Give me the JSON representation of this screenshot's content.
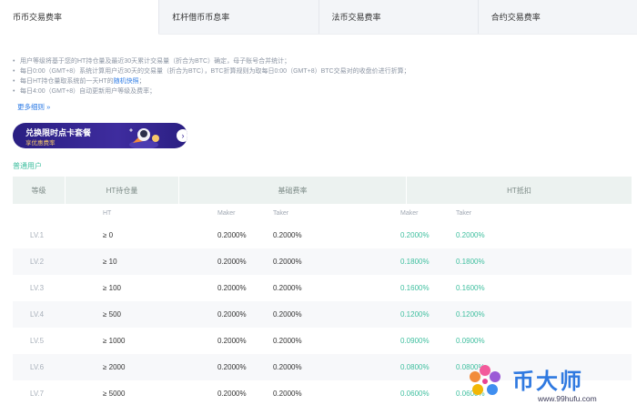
{
  "tabs": [
    {
      "label": "币币交易费率",
      "active": true
    },
    {
      "label": "杠杆借币币息率",
      "active": false
    },
    {
      "label": "法币交易费率",
      "active": false
    },
    {
      "label": "合约交易费率",
      "active": false
    }
  ],
  "notes": {
    "line1": "用户等级将基于您的HT持仓量及最近30天累计交易量（折合为BTC）确定，母子账号合并统计；",
    "line2": "每日0:00（GMT+8）系统计算用户近30天的交易量（折合为BTC），BTC折算规则为取每日0:00（GMT+8）BTC交易对的收盘价进行折算；",
    "line3_prefix": "每日HT持仓量取系统前一天HT的",
    "line3_link": "随机快照",
    "line3_suffix": "；",
    "line4": "每日4:00（GMT+8）自动更新用户等级及费率；",
    "more": "更多细则 »"
  },
  "banner": {
    "title": "兑换限时点卡套餐",
    "subtitle": "享优惠费率",
    "arrow": "›"
  },
  "section_title": "普通用户",
  "table": {
    "headers": {
      "level": "等级",
      "ht_holding": "HT持仓量",
      "base_rate": "基础费率",
      "ht_deduct": "HT抵扣"
    },
    "subheaders": {
      "ht": "HT",
      "maker": "Maker",
      "taker": "Taker",
      "ht_maker": "Maker",
      "ht_taker": "Taker"
    },
    "rows": [
      {
        "level": "LV.1",
        "ht": "≥ 0",
        "maker": "0.2000%",
        "taker": "0.2000%",
        "ht_maker": "0.2000%",
        "ht_taker": "0.2000%"
      },
      {
        "level": "LV.2",
        "ht": "≥ 10",
        "maker": "0.2000%",
        "taker": "0.2000%",
        "ht_maker": "0.1800%",
        "ht_taker": "0.1800%"
      },
      {
        "level": "LV.3",
        "ht": "≥ 100",
        "maker": "0.2000%",
        "taker": "0.2000%",
        "ht_maker": "0.1600%",
        "ht_taker": "0.1600%"
      },
      {
        "level": "LV.4",
        "ht": "≥ 500",
        "maker": "0.2000%",
        "taker": "0.2000%",
        "ht_maker": "0.1200%",
        "ht_taker": "0.1200%"
      },
      {
        "level": "LV.5",
        "ht": "≥ 1000",
        "maker": "0.2000%",
        "taker": "0.2000%",
        "ht_maker": "0.0900%",
        "ht_taker": "0.0900%"
      },
      {
        "level": "LV.6",
        "ht": "≥ 2000",
        "maker": "0.2000%",
        "taker": "0.2000%",
        "ht_maker": "0.0800%",
        "ht_taker": "0.0800%"
      },
      {
        "level": "LV.7",
        "ht": "≥ 5000",
        "maker": "0.2000%",
        "taker": "0.2000%",
        "ht_maker": "0.0600%",
        "ht_taker": "0.0600%"
      }
    ]
  },
  "watermark": {
    "text": "币大师",
    "url": "www.99hufu.com"
  },
  "colors": {
    "accent_green": "#3fbf9f",
    "link_blue": "#2d7be5",
    "banner_purple": "#2a1f82"
  }
}
